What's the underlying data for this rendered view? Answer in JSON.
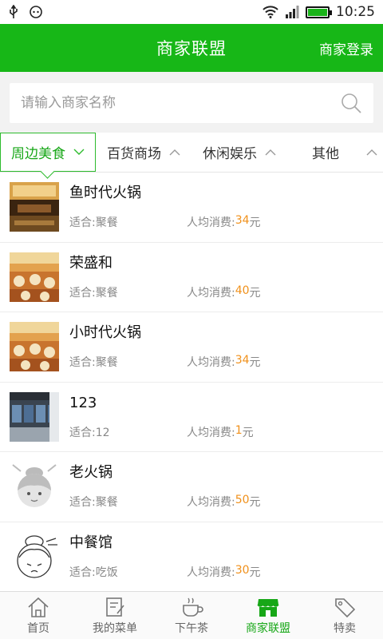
{
  "status": {
    "time": "10:25",
    "icons": [
      "usb-icon",
      "android-debug-icon",
      "wifi-icon",
      "signal-icon",
      "battery-icon"
    ]
  },
  "header": {
    "title": "商家联盟",
    "login": "商家登录"
  },
  "search": {
    "placeholder": "请输入商家名称"
  },
  "tabs": [
    {
      "label": "周边美食",
      "active": true
    },
    {
      "label": "百货商场"
    },
    {
      "label": "休闲娱乐"
    },
    {
      "label": "其他"
    }
  ],
  "list": [
    {
      "name": "鱼时代火锅",
      "suit": "适合:聚餐",
      "avg_label": "人均消费:",
      "avg_value": "34",
      "unit": "元",
      "thumb": "restaurant-hall"
    },
    {
      "name": "荣盛和",
      "suit": "适合:聚餐",
      "avg_label": "人均消费:",
      "avg_value": "40",
      "unit": "元",
      "thumb": "dining-room"
    },
    {
      "name": "小时代火锅",
      "suit": "适合:聚餐",
      "avg_label": "人均消费:",
      "avg_value": "34",
      "unit": "元",
      "thumb": "dining-room"
    },
    {
      "name": "123",
      "suit": "适合:12",
      "avg_label": "人均消费:",
      "avg_value": "1",
      "unit": "元",
      "thumb": "storefront"
    },
    {
      "name": "老火锅",
      "suit": "适合:聚餐",
      "avg_label": "人均消费:",
      "avg_value": "50",
      "unit": "元",
      "thumb": "placeholder-face"
    },
    {
      "name": "中餐馆",
      "suit": "适合:吃饭",
      "avg_label": "人均消费:",
      "avg_value": "30",
      "unit": "元",
      "thumb": "placeholder-face"
    }
  ],
  "nav": [
    {
      "label": "首页",
      "icon": "home-icon"
    },
    {
      "label": "我的菜单",
      "icon": "menu-edit-icon"
    },
    {
      "label": "下午茶",
      "icon": "tea-cup-icon"
    },
    {
      "label": "商家联盟",
      "icon": "store-icon",
      "active": true
    },
    {
      "label": "特卖",
      "icon": "price-tag-icon"
    }
  ],
  "colors": {
    "brand": "#17b717",
    "price": "#f0901a"
  }
}
